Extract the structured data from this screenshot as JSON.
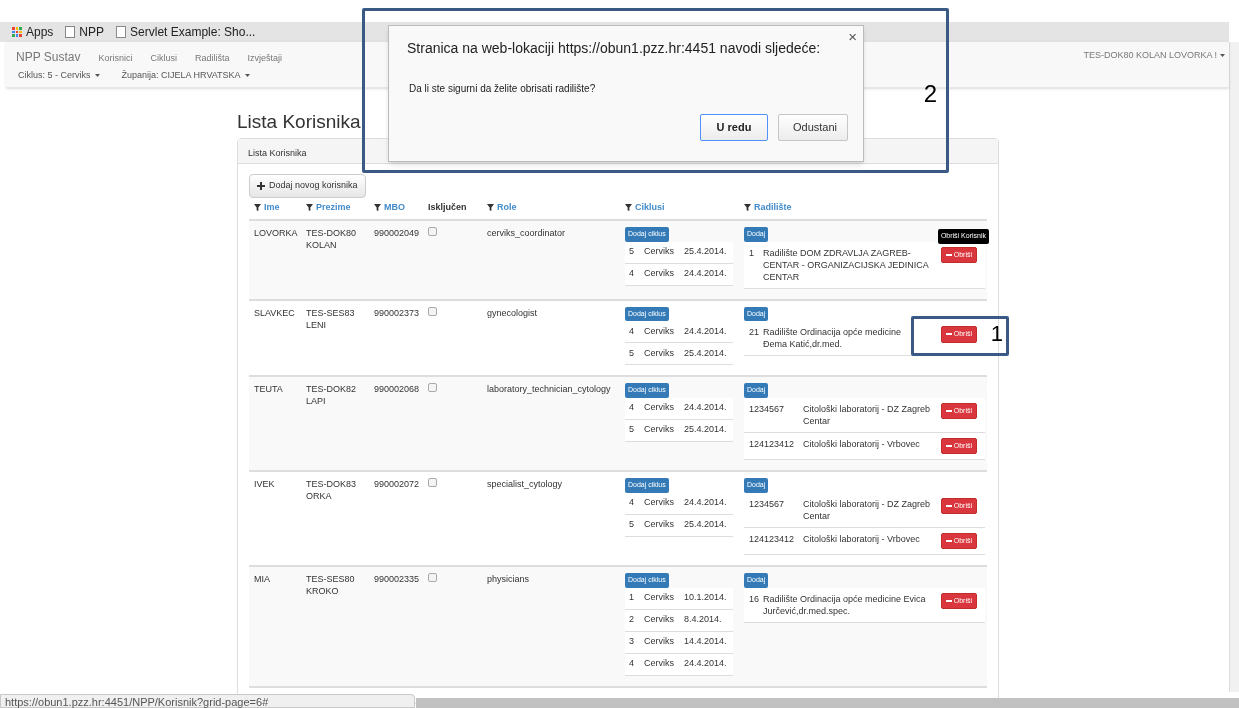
{
  "bookmarks": [
    {
      "kind": "apps",
      "label": "Apps"
    },
    {
      "kind": "page",
      "label": "NPP"
    },
    {
      "kind": "page",
      "label": "Servlet Example: Sho..."
    }
  ],
  "navbar": {
    "brand": "NPP Sustav",
    "menu": [
      "Korisnici",
      "Ciklusi",
      "Radilišta",
      "Izvještaji"
    ],
    "filters": [
      "Ciklus: 5 - Cerviks",
      "Županija: CIJELA HRVATSKA"
    ],
    "user": "TES-DOK80 KOLAN LOVORKA !"
  },
  "page_title": "Lista Korisnika",
  "panel": {
    "title": "Lista Korisnika",
    "add_button": "Dodaj novog korisnika",
    "columns": [
      {
        "label": "Ime",
        "filter": true
      },
      {
        "label": "Prezime",
        "filter": true
      },
      {
        "label": "MBO",
        "filter": true
      },
      {
        "label": "Isključen",
        "filter": false
      },
      {
        "label": "Role",
        "filter": true
      },
      {
        "label": "Ciklusi",
        "filter": true
      },
      {
        "label": "Radilište",
        "filter": true
      }
    ],
    "rows": [
      {
        "ime": "LOVORKA",
        "prezime": "TES-DOK80 KOLAN",
        "mbo": "990002049",
        "excluded": false,
        "role": "cerviks_coordinator",
        "add_cycle": "Dodaj ciklus",
        "cycles": [
          {
            "number": "5",
            "name": "Cerviks",
            "date": "25.4.2014."
          },
          {
            "number": "4",
            "name": "Cerviks",
            "date": "24.4.2014."
          }
        ],
        "add_site": "Dodaj",
        "sites": [
          {
            "code": "1",
            "name": "Radilište DOM ZDRAVLJA ZAGREB-CENTAR - ORGANIZACIJSKA JEDINICA CENTAR",
            "delete": "Obriši",
            "tooltip": "Obriši Korisnik"
          }
        ]
      },
      {
        "ime": "SLAVKEC",
        "prezime": "TES-SES83 LENI",
        "mbo": "990002373",
        "excluded": false,
        "role": "gynecologist",
        "add_cycle": "Dodaj ciklus",
        "cycles": [
          {
            "number": "4",
            "name": "Cerviks",
            "date": "24.4.2014."
          },
          {
            "number": "5",
            "name": "Cerviks",
            "date": "25.4.2014."
          }
        ],
        "add_site": "Dodaj",
        "sites": [
          {
            "code": "21",
            "name": "Radilište Ordinacija opće medicine Đema Katić,dr.med.",
            "delete": "Obriši",
            "annotation": "1"
          }
        ]
      },
      {
        "ime": "TEUTA",
        "prezime": "TES-DOK82 LAPI",
        "mbo": "990002068",
        "excluded": false,
        "role": "laboratory_technician_cytology",
        "add_cycle": "Dodaj ciklus",
        "cycles": [
          {
            "number": "4",
            "name": "Cerviks",
            "date": "24.4.2014."
          },
          {
            "number": "5",
            "name": "Cerviks",
            "date": "25.4.2014."
          }
        ],
        "add_site": "Dodaj",
        "sites": [
          {
            "code": "1234567",
            "name": "Citološki laboratorij - DZ Zagreb Centar",
            "delete": "Obriši"
          },
          {
            "code": "124123412",
            "name": "Citološki laboratorij - Vrbovec",
            "delete": "Obriši"
          }
        ]
      },
      {
        "ime": "IVEK",
        "prezime": "TES-DOK83 ORKA",
        "mbo": "990002072",
        "excluded": false,
        "role": "specialist_cytology",
        "add_cycle": "Dodaj ciklus",
        "cycles": [
          {
            "number": "4",
            "name": "Cerviks",
            "date": "24.4.2014."
          },
          {
            "number": "5",
            "name": "Cerviks",
            "date": "25.4.2014."
          }
        ],
        "add_site": "Dodaj",
        "sites": [
          {
            "code": "1234567",
            "name": "Citološki laboratorij - DZ Zagreb Centar",
            "delete": "Obriši"
          },
          {
            "code": "124123412",
            "name": "Citološki laboratorij - Vrbovec",
            "delete": "Obriši"
          }
        ]
      },
      {
        "ime": "MIA",
        "prezime": "TES-SES80 KROKO",
        "mbo": "990002335",
        "excluded": false,
        "role": "physicians",
        "add_cycle": "Dodaj ciklus",
        "cycles": [
          {
            "number": "1",
            "name": "Cerviks",
            "date": "10.1.2014."
          },
          {
            "number": "2",
            "name": "Cerviks",
            "date": "8.4.2014."
          },
          {
            "number": "3",
            "name": "Cerviks",
            "date": "14.4.2014."
          },
          {
            "number": "4",
            "name": "Cerviks",
            "date": "24.4.2014."
          }
        ],
        "add_site": "Dodaj",
        "sites": [
          {
            "code": "16",
            "name": "Radilište Ordinacija opće medicine Evica Jurčević,dr.med.spec.",
            "delete": "Obriši"
          }
        ]
      }
    ]
  },
  "dialog": {
    "title": "Stranica na web-lokaciji https://obun1.pzz.hr:4451 navodi sljedeće:",
    "message": "Da li ste sigurni da želite obrisati radilište?",
    "buttons": [
      {
        "label": "U redu",
        "selected": true
      },
      {
        "label": "Odustani",
        "selected": false
      }
    ],
    "close": "×",
    "annotation": "2"
  },
  "status_bar": "https://obun1.pzz.hr:4451/NPP/Korisnik?grid-page=6#"
}
